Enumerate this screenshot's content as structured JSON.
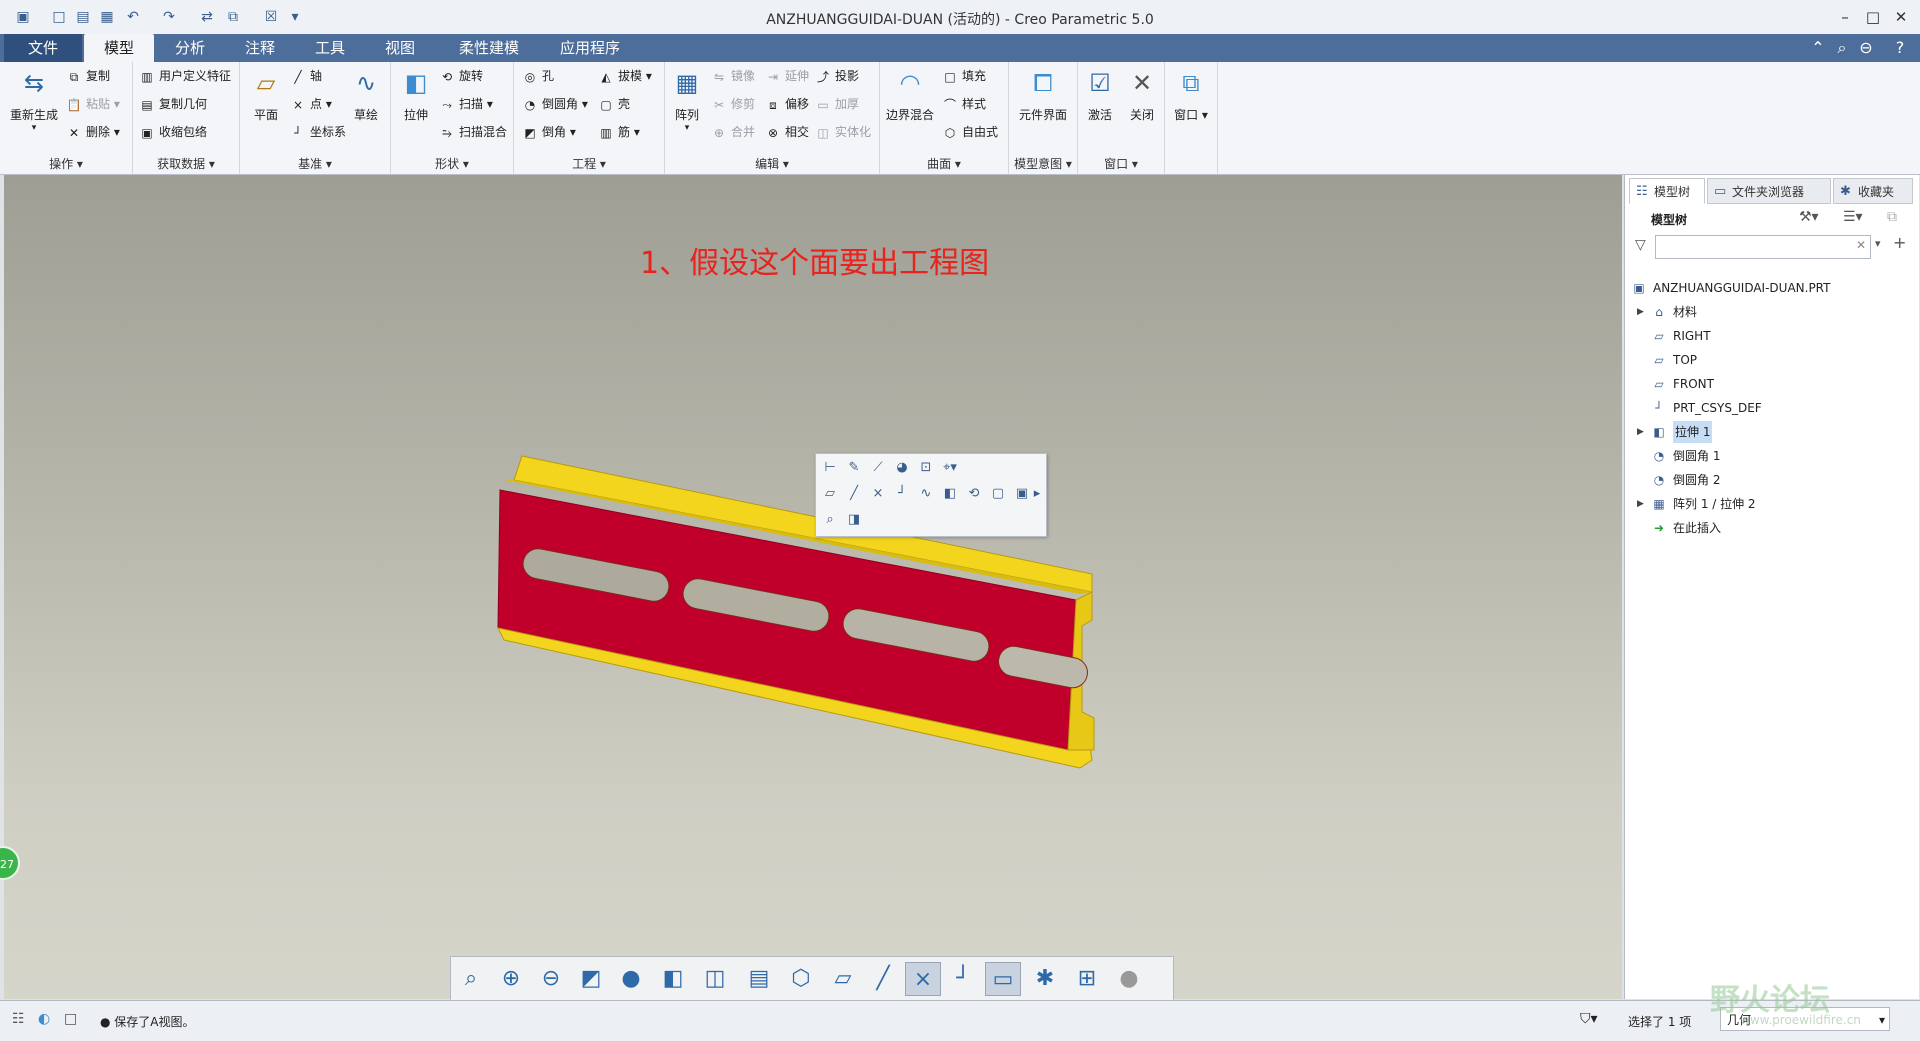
{
  "window": {
    "title": "ANZHUANGGUIDAI-DUAN (活动的) - Creo Parametric 5.0"
  },
  "tabs": [
    {
      "label": "文件"
    },
    {
      "label": "模型"
    },
    {
      "label": "分析"
    },
    {
      "label": "注释"
    },
    {
      "label": "工具"
    },
    {
      "label": "视图"
    },
    {
      "label": "柔性建模"
    },
    {
      "label": "应用程序"
    }
  ],
  "ribbon": {
    "groups": {
      "operations": "操作",
      "get_data": "获取数据",
      "datum": "基准",
      "shapes": "形状",
      "engineering": "工程",
      "editing": "编辑",
      "surfaces": "曲面",
      "model_intent": "模型意图",
      "window": "窗口"
    },
    "regenerate": "重新生成",
    "copy": "复制",
    "paste": "粘贴",
    "delete": "删除",
    "udf": "用户定义特征",
    "copy_geom": "复制几何",
    "shrinkwrap": "收缩包络",
    "plane": "平面",
    "axis": "轴",
    "point": "点",
    "csys": "坐标系",
    "sketch": "草绘",
    "extrude": "拉伸",
    "revolve": "旋转",
    "sweep": "扫描",
    "swept_blend": "扫描混合",
    "hole": "孔",
    "round": "倒圆角",
    "chamfer": "倒角",
    "draft": "拔模",
    "shell": "壳",
    "rib": "筋",
    "pattern": "阵列",
    "mirror": "镜像",
    "extend": "延伸",
    "project": "投影",
    "trim": "修剪",
    "offset": "偏移",
    "thicken": "加厚",
    "merge": "合并",
    "intersect": "相交",
    "solidify": "实体化",
    "boundary_blend": "边界混合",
    "fill": "填充",
    "style": "样式",
    "freestyle": "自由式",
    "component_interface": "元件界面",
    "activate": "激活",
    "close": "关闭",
    "windows": "窗口"
  },
  "viewport": {
    "annotation": "1、假设这个面要出工程图",
    "badge": "27"
  },
  "panel": {
    "tabs": [
      "模型树",
      "文件夹浏览器",
      "收藏夹"
    ],
    "tree_label": "模型树",
    "tree": [
      {
        "label": "ANZHUANGGUIDAI-DUAN.PRT",
        "icon": "part-icon",
        "expand": ""
      },
      {
        "label": "材料",
        "icon": "material-icon",
        "expand": "▶"
      },
      {
        "label": "RIGHT",
        "icon": "datum-plane-icon",
        "expand": ""
      },
      {
        "label": "TOP",
        "icon": "datum-plane-icon",
        "expand": ""
      },
      {
        "label": "FRONT",
        "icon": "datum-plane-icon",
        "expand": ""
      },
      {
        "label": "PRT_CSYS_DEF",
        "icon": "csys-icon",
        "expand": ""
      },
      {
        "label": "拉伸 1",
        "icon": "extrude-icon",
        "expand": "▶"
      },
      {
        "label": "倒圆角 1",
        "icon": "round-icon",
        "expand": ""
      },
      {
        "label": "倒圆角 2",
        "icon": "round-icon",
        "expand": ""
      },
      {
        "label": "阵列 1 / 拉伸 2",
        "icon": "pattern-icon",
        "expand": "▶"
      },
      {
        "label": "在此插入",
        "icon": "insert-here-icon",
        "expand": ""
      }
    ]
  },
  "status": {
    "message": "● 保存了A视图。",
    "selection": "选择了 1 项",
    "filter": "几何"
  },
  "watermark": {
    "text": "野火论坛",
    "url": "www.proewildfire.cn"
  },
  "colors": {
    "accent": "#4d6e9a",
    "part_face": "#c0002a",
    "part_edge": "#f2d51c",
    "annotation": "#e8221c"
  }
}
